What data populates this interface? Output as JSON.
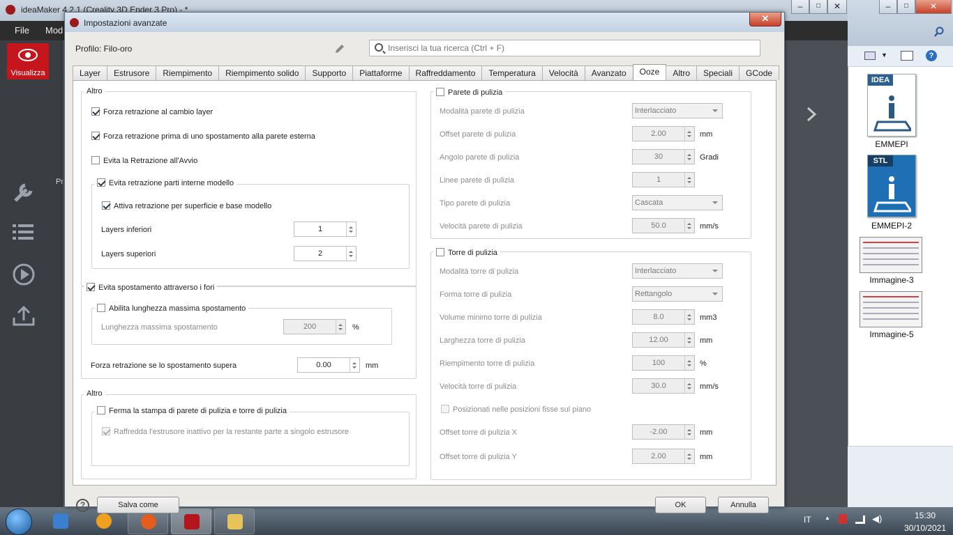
{
  "app": {
    "title": "ideaMaker 4.2.1 (Creality 3D Ender 3 Pro) - *",
    "menu": [
      "File",
      "Mod"
    ],
    "visualizza": "Visualizza",
    "side_tab": "Pr"
  },
  "explorer": {
    "files": [
      "EMMEPI",
      "EMMEPI-2",
      "Immagine-3",
      "Immagine-5"
    ],
    "badges": [
      "IDEA",
      "STL"
    ]
  },
  "taskbar": {
    "lang": "IT",
    "time": "15:30",
    "date": "30/10/2021"
  },
  "dialog": {
    "title": "Impostazioni avanzate",
    "profile_label": "Profilo: Filo-oro",
    "search_placeholder": "Inserisci la tua ricerca (Ctrl + F)",
    "tabs": [
      "Layer",
      "Estrusore",
      "Riempimento",
      "Riempimento solido",
      "Supporto",
      "Piattaforme",
      "Raffreddamento",
      "Temperatura",
      "Velocità",
      "Avanzato",
      "Ooze",
      "Altro",
      "Speciali",
      "GCode"
    ],
    "active_tab": "Ooze",
    "left": {
      "altro1": {
        "title": "Altro",
        "cb1": "Forza retrazione al cambio layer",
        "cb2": "Forza retrazione prima di uno spostamento alla parete esterna",
        "cb3": "Evita la Retrazione all'Avvio",
        "sub_title": "Evita retrazione parti interne modello",
        "cb4": "Attiva retrazione per superficie e base modello",
        "layers_inf_label": "Layers inferiori",
        "layers_inf": "1",
        "layers_sup_label": "Layers superiori",
        "layers_sup": "2"
      },
      "fori": {
        "title": "Evita spostamento attraverso i fori",
        "sub_title": "Abilita lunghezza massima spostamento",
        "lung_label": "Lunghezza massima spostamento",
        "lung_val": "200",
        "lung_unit": "%",
        "forza_label": "Forza retrazione se lo spostamento supera",
        "forza_val": "0.00",
        "forza_unit": "mm"
      },
      "altro2": {
        "title": "Altro",
        "sub_title": "Ferma la stampa di parete di pulizia e torre di pulizia",
        "cb": "Raffredda l'estrusore inattivo per la restante parte a singolo estrusore"
      }
    },
    "right": {
      "parete": {
        "title": "Parete di pulizia",
        "rows": [
          {
            "label": "Modalità parete di pulizia",
            "value": "Interlacciato",
            "type": "combo",
            "unit": ""
          },
          {
            "label": "Offset parete di pulizia",
            "value": "2.00",
            "type": "spin",
            "unit": "mm"
          },
          {
            "label": "Angolo parete di pulizia",
            "value": "30",
            "type": "spin",
            "unit": "Gradi"
          },
          {
            "label": "Linee parete di pulizia",
            "value": "1",
            "type": "spin",
            "unit": ""
          },
          {
            "label": "Tipo parete di pulizia",
            "value": "Cascata",
            "type": "combo",
            "unit": ""
          },
          {
            "label": "Velocità parete di pulizia",
            "value": "50.0",
            "type": "spin",
            "unit": "mm/s"
          }
        ]
      },
      "torre": {
        "title": "Torre di pulizia",
        "rows": [
          {
            "label": "Modalità torre di pulizia",
            "value": "Interlacciato",
            "type": "combo",
            "unit": ""
          },
          {
            "label": "Forma torre di pulizia",
            "value": "Rettangolo",
            "type": "combo",
            "unit": ""
          },
          {
            "label": "Volume minimo torre di pulizia",
            "value": "8.0",
            "type": "spin",
            "unit": "mm3"
          },
          {
            "label": "Larghezza torre di pulizia",
            "value": "12.00",
            "type": "spin",
            "unit": "mm"
          },
          {
            "label": "Riempimento torre di pulizia",
            "value": "100",
            "type": "spin",
            "unit": "%"
          },
          {
            "label": "Velocità torre di pulizia",
            "value": "30.0",
            "type": "spin",
            "unit": "mm/s"
          }
        ],
        "fixed_cb": "Posizionati nelle posizioni fisse sul piano",
        "rows2": [
          {
            "label": "Offset torre di pulizia X",
            "value": "-2.00",
            "type": "spin",
            "unit": "mm"
          },
          {
            "label": "Offset torre di pulizia Y",
            "value": "2.00",
            "type": "spin",
            "unit": "mm"
          }
        ]
      }
    },
    "buttons": {
      "save_as": "Salva come",
      "ok": "OK",
      "cancel": "Annulla"
    }
  }
}
